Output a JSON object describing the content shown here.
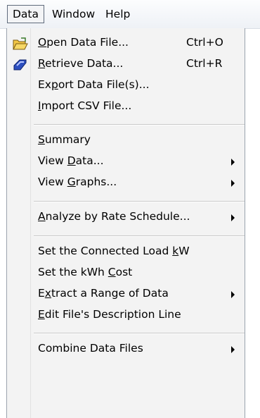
{
  "menubar": {
    "items": [
      {
        "label": "Data",
        "active": true
      },
      {
        "label": "Window"
      },
      {
        "label": "Help"
      }
    ]
  },
  "menu": {
    "items": [
      {
        "pre": "",
        "mn": "O",
        "post": "pen Data File...",
        "shortcut": "Ctrl+O",
        "icon": "open-folder-icon"
      },
      {
        "pre": "",
        "mn": "R",
        "post": "etrieve Data...",
        "shortcut": "Ctrl+R",
        "icon": "retrieve-diamond-icon"
      },
      {
        "pre": "Ex",
        "mn": "p",
        "post": "ort Data File(s)..."
      },
      {
        "pre": "",
        "mn": "I",
        "post": "mport CSV File..."
      },
      {
        "pre": "",
        "mn": "S",
        "post": "ummary"
      },
      {
        "pre": "View ",
        "mn": "D",
        "post": "ata...",
        "submenu": true
      },
      {
        "pre": "View ",
        "mn": "G",
        "post": "raphs...",
        "submenu": true
      },
      {
        "pre": "",
        "mn": "A",
        "post": "nalyze by Rate Schedule...",
        "submenu": true
      },
      {
        "pre": "Set the Connected Load ",
        "mn": "k",
        "post": "W"
      },
      {
        "pre": "Set the kWh ",
        "mn": "C",
        "post": "ost"
      },
      {
        "pre": "E",
        "mn": "x",
        "post": "tract a Range of Data",
        "submenu": true
      },
      {
        "pre": "",
        "mn": "E",
        "post": "dit File's Description Line"
      },
      {
        "pre": "Combine Data Files",
        "mn": "",
        "post": "",
        "submenu": true
      }
    ]
  },
  "colors": {
    "menu_background": "#f3f3f3",
    "folder_yellow": "#f2c646",
    "retrieve_blue": "#2d4fbf"
  }
}
